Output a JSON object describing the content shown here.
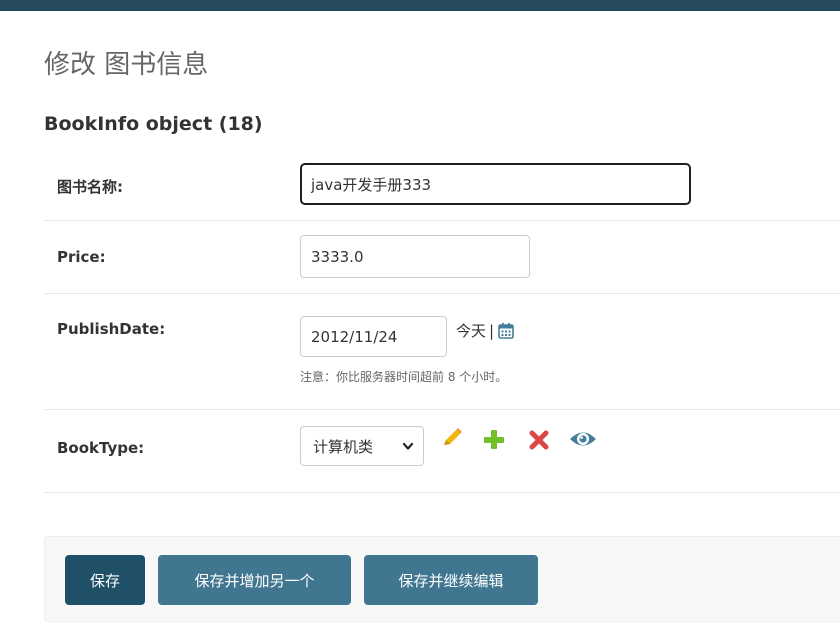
{
  "page": {
    "title": "修改 图书信息",
    "object_title": "BookInfo object (18)"
  },
  "fields": {
    "name": {
      "label": "图书名称:",
      "value": "java开发手册333"
    },
    "price": {
      "label": "Price:",
      "value": "3333.0"
    },
    "publish_date": {
      "label": "PublishDate:",
      "value": "2012/11/24",
      "today_label": "今天",
      "separator": "|",
      "help": "注意：你比服务器时间超前 8 个小时。"
    },
    "book_type": {
      "label": "BookType:",
      "selected": "计算机类"
    }
  },
  "icons": {
    "calendar": "calendar-icon",
    "change": "pencil-icon",
    "add": "plus-icon",
    "delete": "x-icon",
    "view": "eye-icon"
  },
  "colors": {
    "header": "#264b5d",
    "primary_button": "#205067",
    "secondary_button": "#417690",
    "pencil": "#efb80b",
    "plus": "#70bf2b",
    "delete": "#dd4646",
    "view": "#447e9b"
  },
  "actions": {
    "save": "保存",
    "save_add_another": "保存并增加另一个",
    "save_continue": "保存并继续编辑"
  }
}
